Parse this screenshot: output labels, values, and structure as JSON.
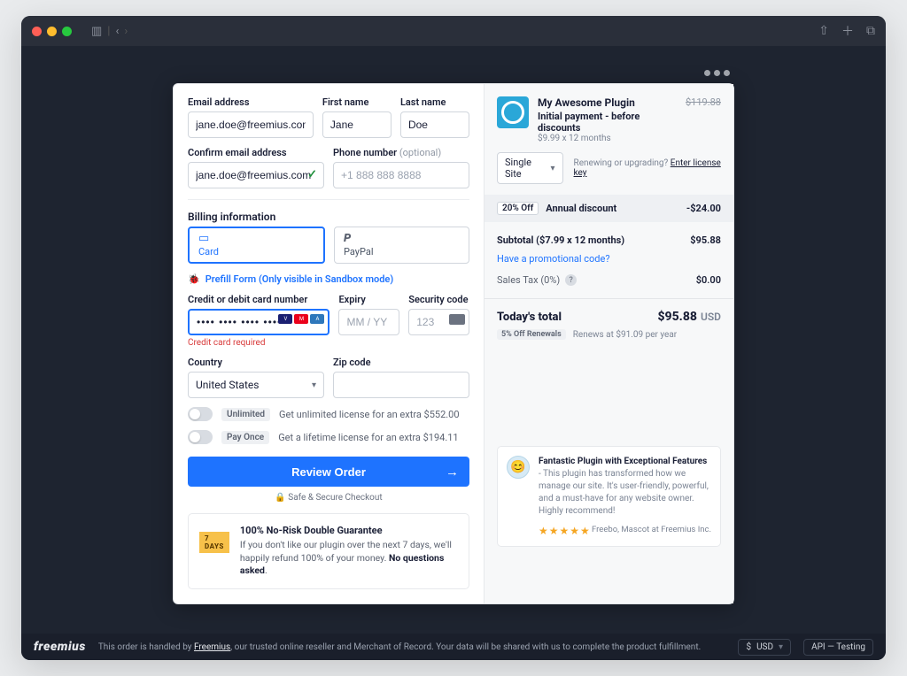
{
  "form": {
    "email_label": "Email address",
    "email_value": "jane.doe@freemius.com",
    "first_label": "First name",
    "first_value": "Jane",
    "last_label": "Last name",
    "last_value": "Doe",
    "confirm_label": "Confirm email address",
    "confirm_value": "jane.doe@freemius.com",
    "phone_label": "Phone number",
    "phone_opt": "(optional)",
    "phone_placeholder": "+1 888 888 8888",
    "billing_header": "Billing information",
    "tab_card": "Card",
    "tab_paypal": "PayPal",
    "sandbox": "Prefill Form (Only visible in Sandbox mode)",
    "card_label": "Credit or debit card number",
    "card_error": "Credit card required",
    "expiry_label": "Expiry",
    "expiry_placeholder": "MM / YY",
    "cvv_label": "Security code",
    "cvv_placeholder": "123",
    "country_label": "Country",
    "country_value": "United States",
    "zip_label": "Zip code",
    "unlimited_pill": "Unlimited",
    "unlimited_text": "Get unlimited license for an extra $552.00",
    "payonce_pill": "Pay Once",
    "payonce_text": "Get a lifetime license for an extra $194.11",
    "review_btn": "Review Order",
    "secure": "Safe & Secure Checkout",
    "guarantee_badge": "7 DAYS",
    "guarantee_title": "100% No-Risk Double Guarantee",
    "guarantee_body_a": "If you don't like our plugin over the next 7 days, we'll happily refund 100% of your money. ",
    "guarantee_body_b": "No questions asked"
  },
  "summary": {
    "product": "My Awesome Plugin",
    "initial_label": "Initial payment - before discounts",
    "initial_rate": "$9.99 x 12 months",
    "initial_strike": "$119.88",
    "license_value": "Single Site",
    "renew_q": "Renewing or upgrading?",
    "renew_link": "Enter license key",
    "discount_pct": "20% Off",
    "discount_label": "Annual discount",
    "discount_amt": "-$24.00",
    "subtotal_label": "Subtotal ($7.99 x 12 months)",
    "subtotal_value": "$95.88",
    "promo": "Have a promotional code?",
    "tax_label": "Sales Tax (0%)",
    "tax_value": "$0.00",
    "total_label": "Today's total",
    "total_value": "$95.88",
    "total_currency": "USD",
    "renewal_badge": "5% Off Renewals",
    "renewal_note": "Renews at $91.09 per year",
    "testi_title": "Fantastic Plugin with Exceptional Features",
    "testi_body": " - This plugin has transformed how we manage our site. It's user-friendly, powerful, and a must-have for any website owner. Highly recommend!",
    "testi_by": "Freebo, Mascot at Freemius Inc."
  },
  "footer": {
    "brand": "freemius",
    "msg_a": "This order is handled by ",
    "msg_link": "Freemius",
    "msg_b": ", our trusted online reseller and Merchant of Record. Your data will be shared with us to complete the product fulfillment.",
    "currency": "USD",
    "api": "API — Testing"
  }
}
